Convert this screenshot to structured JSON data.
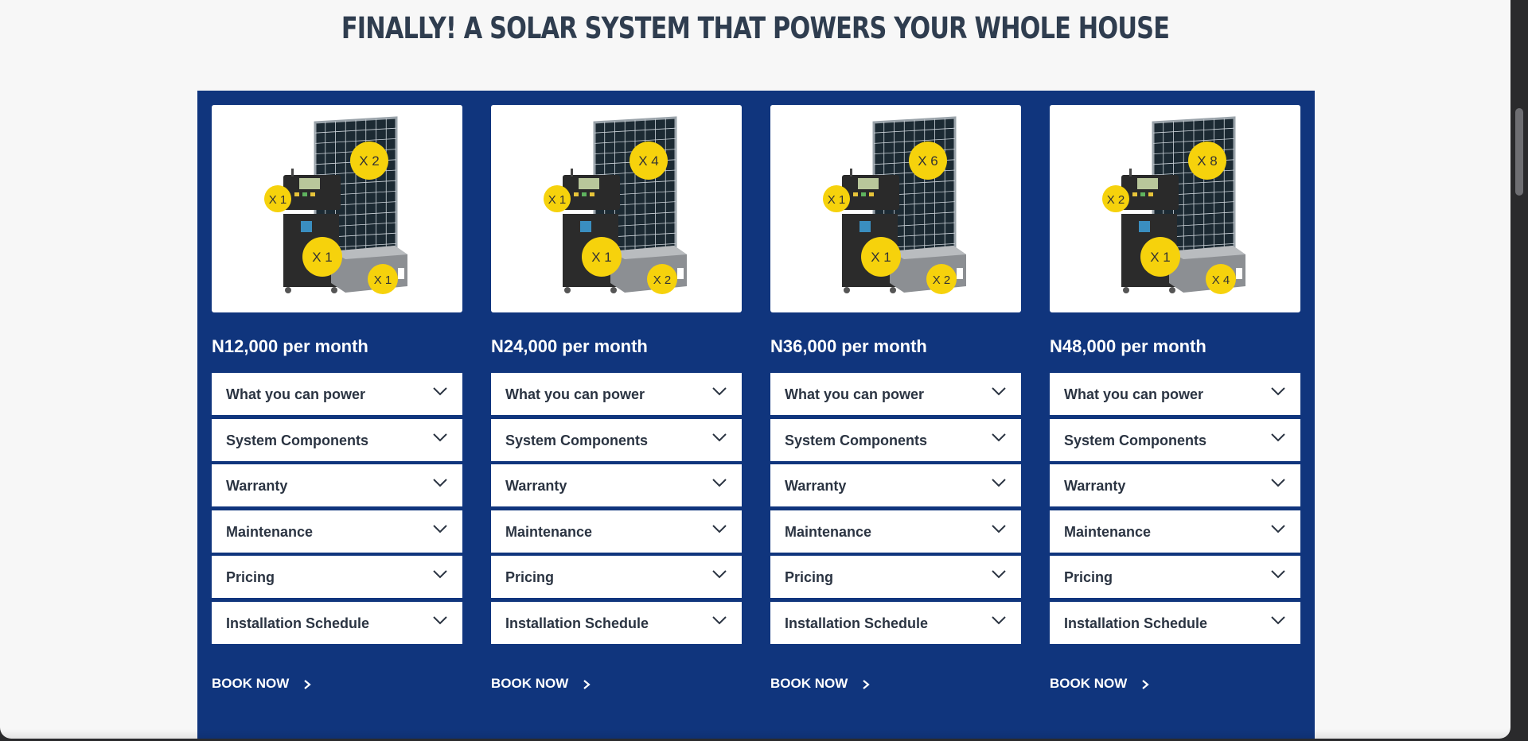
{
  "page": {
    "headline": "FINALLY! A SOLAR SYSTEM THAT POWERS YOUR WHOLE HOUSE"
  },
  "plans": [
    {
      "price": "N12,000 per month",
      "badges": {
        "controller": "X 1",
        "panel": "X 2",
        "inverter": "X 1",
        "battery": "X 1"
      },
      "accordion": [
        "What you can power",
        "System Components",
        "Warranty",
        "Maintenance",
        "Pricing",
        "Installation Schedule"
      ],
      "cta": "BOOK NOW"
    },
    {
      "price": "N24,000 per month",
      "badges": {
        "controller": "X 1",
        "panel": "X 4",
        "inverter": "X 1",
        "battery": "X 2"
      },
      "accordion": [
        "What you can power",
        "System Components",
        "Warranty",
        "Maintenance",
        "Pricing",
        "Installation Schedule"
      ],
      "cta": "BOOK NOW"
    },
    {
      "price": "N36,000 per month",
      "badges": {
        "controller": "X 1",
        "panel": "X 6",
        "inverter": "X 1",
        "battery": "X 2"
      },
      "accordion": [
        "What you can power",
        "System Components",
        "Warranty",
        "Maintenance",
        "Pricing",
        "Installation Schedule"
      ],
      "cta": "BOOK NOW"
    },
    {
      "price": "N48,000 per month",
      "badges": {
        "controller": "X 2",
        "panel": "X 8",
        "inverter": "X 1",
        "battery": "X 4"
      },
      "accordion": [
        "What you can power",
        "System Components",
        "Warranty",
        "Maintenance",
        "Pricing",
        "Installation Schedule"
      ],
      "cta": "BOOK NOW"
    }
  ],
  "colors": {
    "panel_bg": "#10357d",
    "badge_yellow": "#f6d20c",
    "headline": "#2f3d4f"
  },
  "icons": {
    "accordion": "chevron-down-icon",
    "cta": "chevron-right-icon"
  }
}
